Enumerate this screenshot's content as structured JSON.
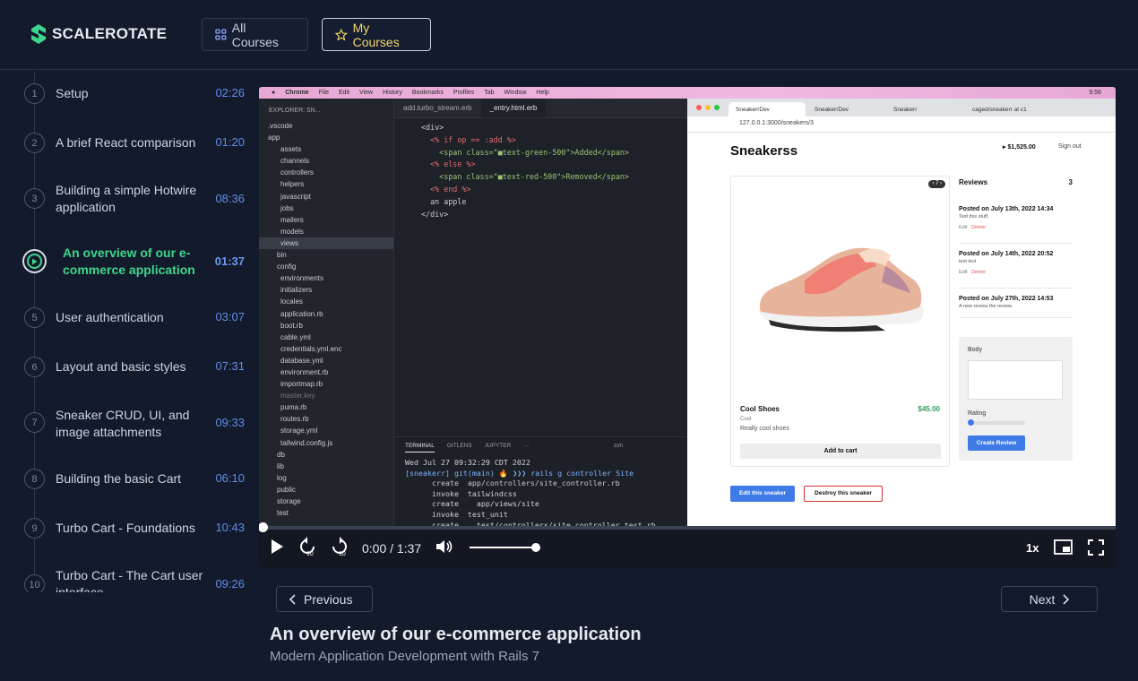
{
  "brand": {
    "name": "SCALEROTATE"
  },
  "nav": {
    "all_courses": "All Courses",
    "my_courses": "My Courses"
  },
  "lessons": [
    {
      "num": "1",
      "title": "Setup",
      "duration": "02:26"
    },
    {
      "num": "2",
      "title": "A brief React comparison",
      "duration": "01:20"
    },
    {
      "num": "3",
      "title": "Building a simple Hotwire application",
      "duration": "08:36"
    },
    {
      "num": "4",
      "title": "An overview of our e-commerce application",
      "duration": "01:37",
      "active": true
    },
    {
      "num": "5",
      "title": "User authentication",
      "duration": "03:07"
    },
    {
      "num": "6",
      "title": "Layout and basic styles",
      "duration": "07:31"
    },
    {
      "num": "7",
      "title": "Sneaker CRUD, UI, and image attachments",
      "duration": "09:33"
    },
    {
      "num": "8",
      "title": "Building the basic Cart",
      "duration": "06:10"
    },
    {
      "num": "9",
      "title": "Turbo Cart - Foundations",
      "duration": "10:43"
    },
    {
      "num": "10",
      "title": "Turbo Cart - The Cart user interface",
      "duration": "09:26"
    }
  ],
  "video": {
    "menubar": [
      "Chrome",
      "File",
      "Edit",
      "View",
      "History",
      "Bookmarks",
      "Profiles",
      "Tab",
      "Window",
      "Help"
    ],
    "clock": "9:56",
    "search": "sneakerr",
    "explorer_title": "EXPLORER: SN...",
    "tree": [
      ".vscode",
      "app",
      "assets",
      "channels",
      "controllers",
      "helpers",
      "javascript",
      "jobs",
      "mailers",
      "models",
      "views",
      "bin",
      "config",
      "environments",
      "initializers",
      "locales",
      "application.rb",
      "boot.rb",
      "cable.yml",
      "credentials.yml.enc",
      "database.yml",
      "environment.rb",
      "importmap.rb",
      "master.key",
      "puma.rb",
      "routes.rb",
      "storage.yml",
      "tailwind.config.js",
      "db",
      "lib",
      "log",
      "public",
      "storage",
      "test"
    ],
    "editor_tabs": [
      "add.turbo_stream.erb",
      "_entry.html.erb"
    ],
    "code": [
      "<div>",
      "  <% if op == :add %>",
      "    <span class=\"■text-green-500\">Added</span>",
      "  <% else %>",
      "    <span class=\"■text-red-500\">Removed</span>",
      "  <% end %>",
      "  an apple",
      "</div>"
    ],
    "terminal_tabs": [
      "TERMINAL",
      "GITLENS",
      "JUPYTER",
      "···"
    ],
    "terminal_shell": "zsh",
    "terminal": [
      "Wed Jul 27 09:32:29 CDT 2022",
      "[sneakerr] git(main) 🔥 ❯❯❯ rails g controller Site",
      "      create  app/controllers/site_controller.rb",
      "      invoke  tailwindcss",
      "      create    app/views/site",
      "      invoke  test_unit",
      "      create    test/controllers/site_controller_test.rb"
    ],
    "browser_tabs": [
      "SneakerrDev",
      "SneakerrDev",
      "Sneakerr",
      "caged/sneakerr at c1"
    ],
    "url": "127.0.0.1:3000/sneakers/3",
    "site": {
      "title": "Sneakerss",
      "balance": "▸ $1,525.00",
      "sign_out": "Sign out",
      "badge": "‹ 7 ›",
      "product_name": "Cool Shoes",
      "price": "$45.00",
      "category": "Cool",
      "desc": "Really cool shoes",
      "add_to_cart": "Add to cart",
      "reviews_title": "Reviews",
      "reviews_count": "3",
      "reviews": [
        {
          "posted": "Posted on July 13th, 2022 14:34",
          "body": "Test this stuff.",
          "actions": true
        },
        {
          "posted": "Posted on July 14th, 2022 20:52",
          "body": "test test",
          "actions": true
        },
        {
          "posted": "Posted on July 27th, 2022 14:53",
          "body": "A new review the review.",
          "actions": false
        }
      ],
      "edit": "Edit",
      "delete": "Delete",
      "form_body": "Body",
      "form_rating": "Rating",
      "create_review": "Create Review",
      "rating_level": 0,
      "edit_sneaker": "Edit this sneaker",
      "destroy_sneaker": "Destroy this sneaker"
    },
    "player": {
      "time": "0:00 / 1:37",
      "speed": "1x",
      "progress": 0,
      "volume": 1.0
    }
  },
  "pager": {
    "previous": "Previous",
    "next": "Next"
  },
  "current": {
    "title": "An overview of our e-commerce application",
    "course": "Modern Application Development with Rails 7"
  },
  "colors": {
    "accent_green": "#3fd58d",
    "accent_blue": "#5f8ee8",
    "star": "#f3d66b"
  }
}
